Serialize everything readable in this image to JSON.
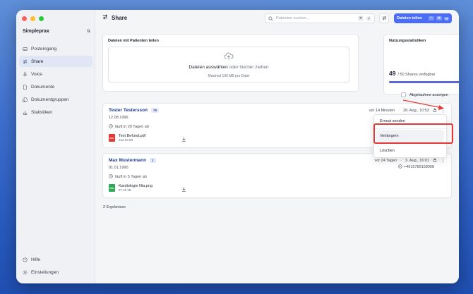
{
  "sidebar": {
    "org_name": "Simpleprax",
    "items": [
      {
        "label": "Posteingang",
        "icon": "inbox-icon",
        "active": false
      },
      {
        "label": "Share",
        "icon": "share-arrows-icon",
        "active": true
      },
      {
        "label": "Voice",
        "icon": "microphone-icon",
        "active": false
      },
      {
        "label": "Dokumente",
        "icon": "document-icon",
        "active": false
      },
      {
        "label": "Dokumentgruppen",
        "icon": "document-group-icon",
        "active": false
      },
      {
        "label": "Statistiken",
        "icon": "bar-chart-icon",
        "active": false
      }
    ],
    "bottom": [
      {
        "label": "Hilfe",
        "icon": "help-icon"
      },
      {
        "label": "Einstellungen",
        "icon": "settings-icon"
      }
    ]
  },
  "header": {
    "title": "Share",
    "search_placeholder": "Patienten suchen...",
    "search_kbd": [
      "⌘",
      "F"
    ],
    "share_button_label": "Dateien teilen",
    "share_button_kbd": [
      "⌃",
      "⌘",
      "N"
    ]
  },
  "upload": {
    "title": "Dateien mit Patienten teilen",
    "main_text": "Dateien auswählen",
    "or_text": " oder hierher ziehen",
    "sub_text": "Maximal 100 MB pro Datei"
  },
  "stats": {
    "title": "Nutzungsstatistiken",
    "used": "49",
    "available_text": "/ 50 Shares verfügbar",
    "fraction": 0.98,
    "accent": "#5a67d8"
  },
  "filter": {
    "label": "Abgelaufene anzeigen",
    "checked": false
  },
  "shares": [
    {
      "name": "Tester Testersson",
      "count": "79",
      "dob": "12.08.1996",
      "expiry": "läuft in 29 Tagen ab",
      "time_ago": "vor 14 Minuten",
      "date": "28. Aug., 10:53",
      "contact": "",
      "file": {
        "name": "Test Befund.pdf",
        "size": "232.03 kB",
        "type": "PDF"
      }
    },
    {
      "name": "Max Mustermann",
      "count": "1",
      "dob": "01.01.1990",
      "expiry": "läuft in 5 Tagen ab",
      "time_ago": "vor 24 Tagen",
      "date": "3. Aug., 16:01",
      "contact": "+4915789158068",
      "file": {
        "name": "Kardiologie Nia.png",
        "size": "97.46 kB",
        "type": "PNG"
      }
    }
  ],
  "results_text": "2 Ergebnisse",
  "context_menu": {
    "items": [
      "Erneut senden",
      "Verlängern",
      "Löschen"
    ],
    "highlighted": "Verlängern"
  },
  "colors": {
    "primary": "#4a6cf7",
    "annotation": "#e53935",
    "name": "#1f3a8a"
  }
}
